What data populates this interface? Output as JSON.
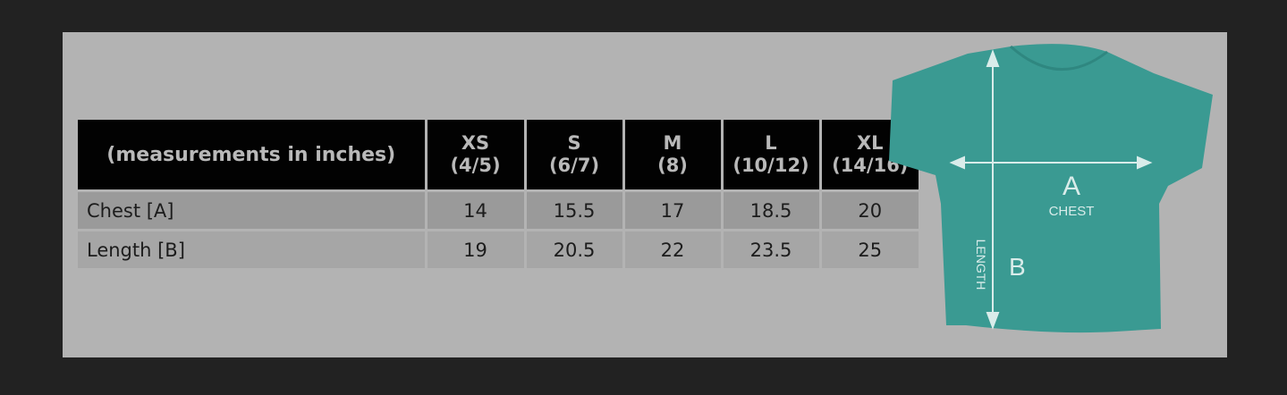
{
  "table": {
    "header_label": "(measurements in inches)",
    "columns": [
      {
        "size": "XS",
        "alt": "(4/5)"
      },
      {
        "size": "S",
        "alt": "(6/7)"
      },
      {
        "size": "M",
        "alt": "(8)"
      },
      {
        "size": "L",
        "alt": "(10/12)"
      },
      {
        "size": "XL",
        "alt": "(14/16)"
      }
    ],
    "rows": [
      {
        "label": "Chest [A]",
        "values": [
          "14",
          "15.5",
          "17",
          "18.5",
          "20"
        ]
      },
      {
        "label": "Length [B]",
        "values": [
          "19",
          "20.5",
          "22",
          "23.5",
          "25"
        ]
      }
    ]
  },
  "diagram": {
    "chest_letter": "A",
    "chest_label": "CHEST",
    "length_letter": "B",
    "length_label": "LENGTH",
    "shirt_color": "#3a9a92"
  },
  "colors": {
    "background": "#222222",
    "panel": "#b3b3b3",
    "header_bg": "#020202",
    "header_text": "#b9b9b9"
  }
}
